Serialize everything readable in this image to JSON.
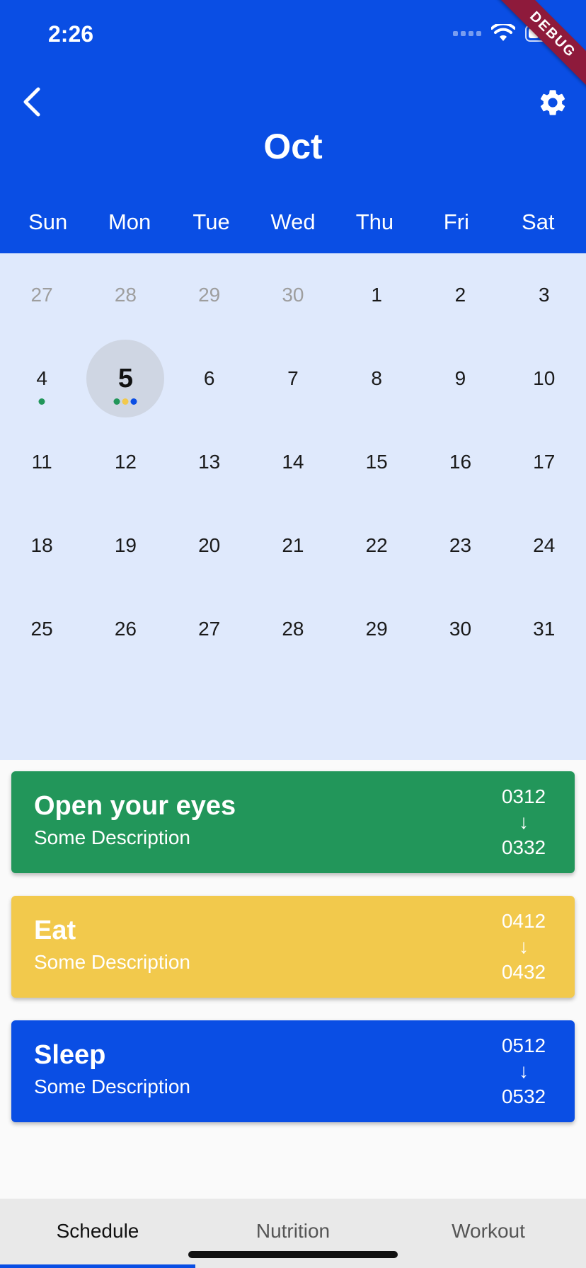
{
  "status_bar": {
    "time": "2:26"
  },
  "debug_banner": "DEBUG",
  "header": {
    "month": "Oct"
  },
  "weekdays": [
    "Sun",
    "Mon",
    "Tue",
    "Wed",
    "Thu",
    "Fri",
    "Sat"
  ],
  "calendar": {
    "selected_day": "5",
    "days": [
      {
        "label": "27",
        "muted": true
      },
      {
        "label": "28",
        "muted": true
      },
      {
        "label": "29",
        "muted": true
      },
      {
        "label": "30",
        "muted": true
      },
      {
        "label": "1"
      },
      {
        "label": "2"
      },
      {
        "label": "3"
      },
      {
        "label": "4",
        "dots": [
          "#22965A"
        ]
      },
      {
        "label": "5",
        "selected": true,
        "dots": [
          "#22965A",
          "#F2C94C",
          "#0A4EE4"
        ]
      },
      {
        "label": "6"
      },
      {
        "label": "7"
      },
      {
        "label": "8"
      },
      {
        "label": "9"
      },
      {
        "label": "10"
      },
      {
        "label": "11"
      },
      {
        "label": "12"
      },
      {
        "label": "13"
      },
      {
        "label": "14"
      },
      {
        "label": "15"
      },
      {
        "label": "16"
      },
      {
        "label": "17"
      },
      {
        "label": "18"
      },
      {
        "label": "19"
      },
      {
        "label": "20"
      },
      {
        "label": "21"
      },
      {
        "label": "22"
      },
      {
        "label": "23"
      },
      {
        "label": "24"
      },
      {
        "label": "25"
      },
      {
        "label": "26"
      },
      {
        "label": "27"
      },
      {
        "label": "28"
      },
      {
        "label": "29"
      },
      {
        "label": "30"
      },
      {
        "label": "31"
      }
    ]
  },
  "events": [
    {
      "title": "Open your eyes",
      "description": "Some Description",
      "start": "0312",
      "arrow": "↓",
      "end": "0332",
      "color": "#22965A"
    },
    {
      "title": "Eat",
      "description": "Some Description",
      "start": "0412",
      "arrow": "↓",
      "end": "0432",
      "color": "#F2C94C"
    },
    {
      "title": "Sleep",
      "description": "Some Description",
      "start": "0512",
      "arrow": "↓",
      "end": "0532",
      "color": "#0A4EE4"
    }
  ],
  "bottom_nav": {
    "tabs": [
      {
        "label": "Schedule",
        "active": true
      },
      {
        "label": "Nutrition"
      },
      {
        "label": "Workout"
      }
    ]
  },
  "colors": {
    "primary": "#0A4EE4",
    "calendar_bg": "#DFE9FC",
    "selected_circle": "#CFD6E3"
  },
  "icons": {
    "back": "chevron-left-icon",
    "settings": "gear-icon",
    "wifi": "wifi-icon",
    "battery": "battery-icon"
  }
}
